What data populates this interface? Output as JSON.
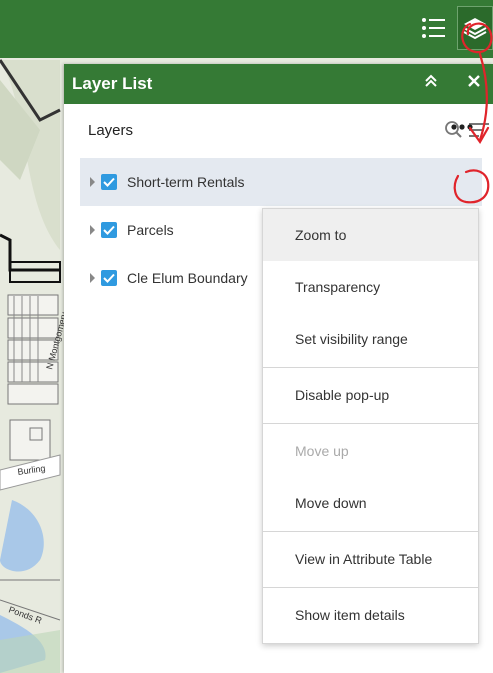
{
  "panel": {
    "title": "Layer List",
    "layers_heading": "Layers"
  },
  "layers": [
    {
      "name": "Short-term Rentals",
      "checked": true,
      "selected": true
    },
    {
      "name": "Parcels",
      "checked": true,
      "selected": false
    },
    {
      "name": "Cle Elum Boundary",
      "checked": true,
      "selected": false
    }
  ],
  "menu": {
    "items": [
      {
        "label": "Zoom to"
      },
      {
        "label": "Transparency"
      },
      {
        "label": "Set visibility range"
      },
      {
        "label": "Disable pop-up"
      },
      {
        "label": "Move up"
      },
      {
        "label": "Move down"
      },
      {
        "label": "View in Attribute Table"
      },
      {
        "label": "Show item details"
      }
    ]
  },
  "map": {
    "labels": [
      "N Montgomery",
      "Burling",
      "Ponds R"
    ]
  },
  "colors": {
    "header_green": "#357a35",
    "checkbox_blue": "#2f9ae0",
    "annotation_red": "#e0242b"
  }
}
